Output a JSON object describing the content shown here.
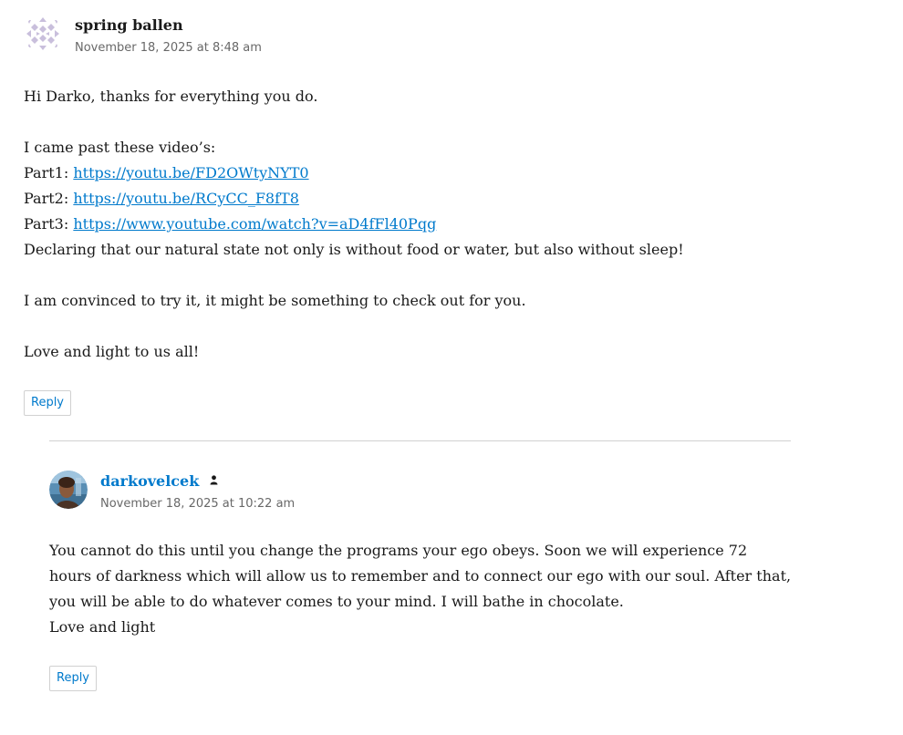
{
  "comments": [
    {
      "author": "spring ballen",
      "date": "November 18, 2025 at 8:48 am",
      "lines": {
        "greeting": "Hi Darko, thanks for everything you do.",
        "intro": "I came past these video’s:",
        "part1_label": "Part1: ",
        "part1_link": "https://youtu.be/FD2OWtyNYT0",
        "part2_label": "Part2: ",
        "part2_link": "https://youtu.be/RCyCC_F8fT8",
        "part3_label": "Part3: ",
        "part3_link": "https://www.youtube.com/watch?v=aD4fFl40Pqg",
        "declaring": "Declaring that our natural state not only is without food or water, but also without sleep!",
        "convinced": "I am convinced to try it, it might be something to check out for you.",
        "closing": "Love and light to us all!"
      },
      "reply_label": "Reply"
    },
    {
      "author": "darkovelcek",
      "date": "November 18, 2025 at 10:22 am",
      "lines": {
        "paragraph": "You cannot do this until you change the programs your ego obeys. Soon we will experience 72 hours of darkness which will allow us to remember and to connect our ego with our soul. After that, you will be able to do whatever comes to your mind. I will bathe in chocolate.",
        "closing": "Love and light"
      },
      "reply_label": "Reply"
    }
  ],
  "colors": {
    "link": "#007acc",
    "text": "#1a1a1a",
    "meta": "#686868",
    "border": "#d1d1d1"
  },
  "icons": {
    "author_badge": "user-icon"
  }
}
